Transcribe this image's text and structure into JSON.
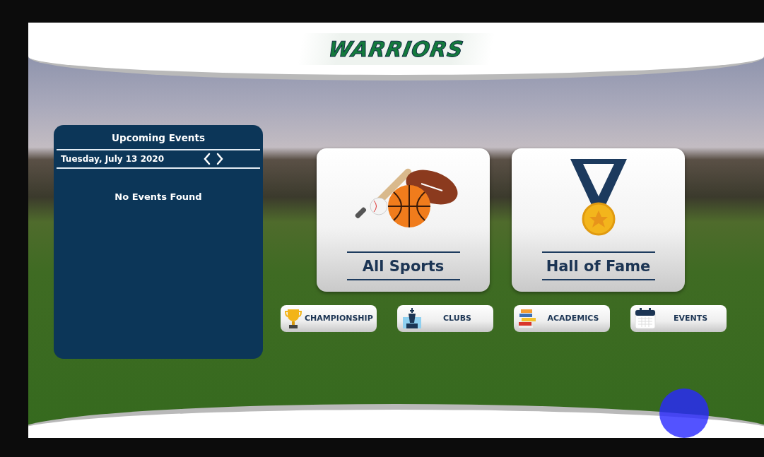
{
  "header": {
    "logo": "WARRIORS"
  },
  "events_panel": {
    "title": "Upcoming Events",
    "date": "Tuesday, July 13 2020",
    "message": "No Events Found"
  },
  "tiles": [
    {
      "label": "All Sports",
      "kind": "sports"
    },
    {
      "label": "Hall of Fame",
      "kind": "medal"
    }
  ],
  "buttons": [
    {
      "label": "CHAMPIONSHIP",
      "kind": "trophy"
    },
    {
      "label": "CLUBS",
      "kind": "chess"
    },
    {
      "label": "ACADEMICS",
      "kind": "books"
    },
    {
      "label": "EVENTS",
      "kind": "calendar"
    }
  ]
}
